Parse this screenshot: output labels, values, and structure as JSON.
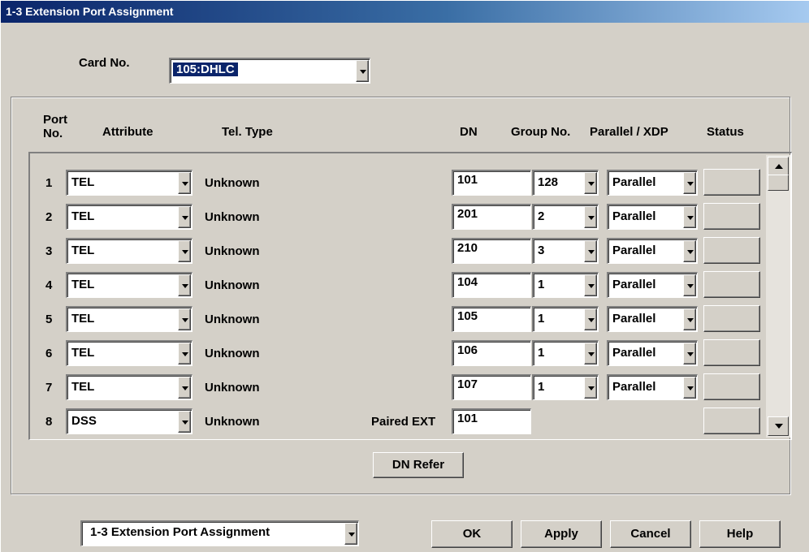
{
  "window": {
    "title": "1-3 Extension Port Assignment"
  },
  "card": {
    "label": "Card No.",
    "value": "105:DHLC"
  },
  "columns": {
    "port_no": "Port\nNo.",
    "attribute": "Attribute",
    "tel_type": "Tel. Type",
    "dn": "DN",
    "group_no": "Group No.",
    "parallel_xdp": "Parallel / XDP",
    "status": "Status"
  },
  "rows": [
    {
      "port": "1",
      "attribute": "TEL",
      "tel_type": "Unknown",
      "dn": "101",
      "group": "128",
      "parallel": "Parallel"
    },
    {
      "port": "2",
      "attribute": "TEL",
      "tel_type": "Unknown",
      "dn": "201",
      "group": "2",
      "parallel": "Parallel"
    },
    {
      "port": "3",
      "attribute": "TEL",
      "tel_type": "Unknown",
      "dn": "210",
      "group": "3",
      "parallel": "Parallel"
    },
    {
      "port": "4",
      "attribute": "TEL",
      "tel_type": "Unknown",
      "dn": "104",
      "group": "1",
      "parallel": "Parallel"
    },
    {
      "port": "5",
      "attribute": "TEL",
      "tel_type": "Unknown",
      "dn": "105",
      "group": "1",
      "parallel": "Parallel"
    },
    {
      "port": "6",
      "attribute": "TEL",
      "tel_type": "Unknown",
      "dn": "106",
      "group": "1",
      "parallel": "Parallel"
    },
    {
      "port": "7",
      "attribute": "TEL",
      "tel_type": "Unknown",
      "dn": "107",
      "group": "1",
      "parallel": "Parallel"
    },
    {
      "port": "8",
      "attribute": "DSS",
      "tel_type": "Unknown",
      "paired_label": "Paired EXT",
      "dn": "101"
    }
  ],
  "buttons": {
    "dn_refer": "DN Refer",
    "ok": "OK",
    "apply": "Apply",
    "cancel": "Cancel",
    "help": "Help"
  },
  "footer": {
    "screen_select": "1-3 Extension Port Assignment"
  },
  "colors": {
    "face": "#d4d0c8",
    "title_start": "#0a246a",
    "selection": "#0a246a"
  }
}
